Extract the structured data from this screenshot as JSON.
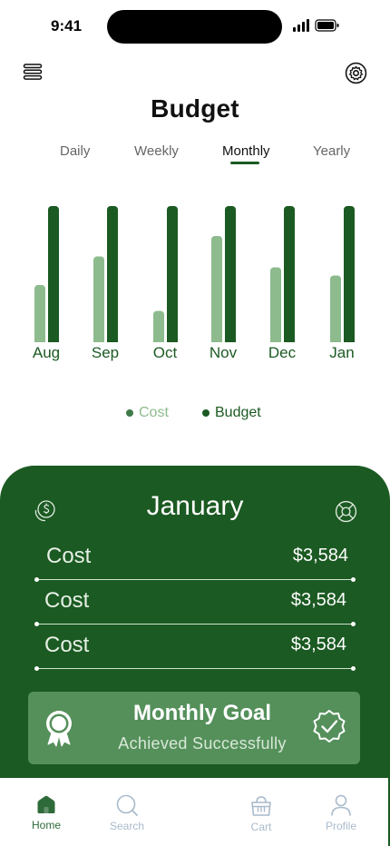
{
  "status_bar": {
    "time": "9:41"
  },
  "header": {
    "title": "Budget",
    "menu_icon": "menu-icon",
    "settings_icon": "gear-icon"
  },
  "tabs": [
    {
      "label": "Daily",
      "active": false
    },
    {
      "label": "Weekly",
      "active": false
    },
    {
      "label": "Monthly",
      "active": true
    },
    {
      "label": "Yearly",
      "active": false
    }
  ],
  "colors": {
    "primary": "#1b5a22",
    "cost": "#8dbb8e",
    "budget": "#1b5a22",
    "goal_box": "#55905b",
    "nav_inactive": "#a9bacb"
  },
  "chart_data": {
    "type": "bar",
    "categories": [
      "Aug",
      "Sep",
      "Oct",
      "Nov",
      "Dec",
      "Jan"
    ],
    "series": [
      {
        "name": "Cost",
        "values": [
          42,
          63,
          23,
          78,
          55,
          49
        ]
      },
      {
        "name": "Budget",
        "values": [
          100,
          100,
          100,
          100,
          100,
          100
        ]
      }
    ],
    "ylim": [
      0,
      100
    ],
    "grid": false,
    "legend": "bottom-center"
  },
  "legend": [
    {
      "label": "Cost",
      "color": "#8dbb8e"
    },
    {
      "label": "Budget",
      "color": "#1b5a22"
    }
  ],
  "summary": {
    "month": "January",
    "coin_icon": "dollar-coin-icon",
    "help_icon": "lifebuoy-icon",
    "rows": [
      {
        "label": "Cost",
        "value": "$3,584"
      },
      {
        "label": "Cost",
        "value": "$3,584"
      },
      {
        "label": "Cost",
        "value": "$3,584"
      }
    ],
    "goal": {
      "title": "Monthly Goal",
      "subtitle": "Achieved Successfully",
      "award_icon": "award-ribbon-icon",
      "check_icon": "badge-check-icon"
    }
  },
  "nav": [
    {
      "label": "Home",
      "icon": "home-icon",
      "active": true
    },
    {
      "label": "Search",
      "icon": "search-icon",
      "active": false
    },
    {
      "label": "Cart",
      "icon": "basket-icon",
      "active": false
    },
    {
      "label": "Profile",
      "icon": "profile-icon",
      "active": false
    }
  ]
}
